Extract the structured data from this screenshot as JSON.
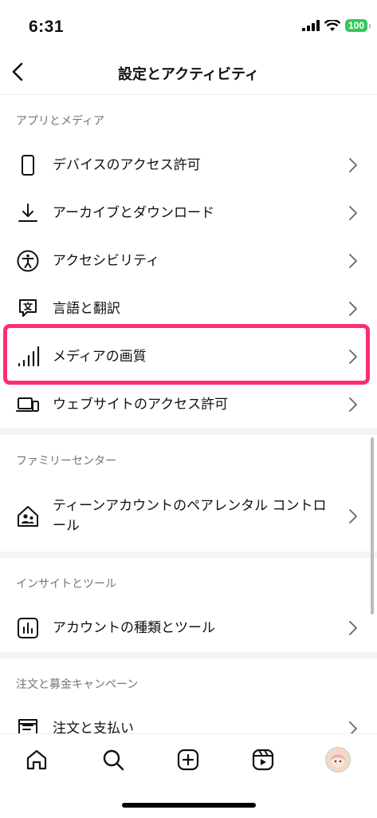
{
  "status": {
    "time": "6:31",
    "battery": "100"
  },
  "header": {
    "title": "設定とアクティビティ"
  },
  "sections": [
    {
      "title": "アプリとメディア",
      "items": [
        {
          "label": "デバイスのアクセス許可",
          "icon": "phone-icon"
        },
        {
          "label": "アーカイブとダウンロード",
          "icon": "download-icon"
        },
        {
          "label": "アクセシビリティ",
          "icon": "accessibility-icon"
        },
        {
          "label": "言語と翻訳",
          "icon": "translate-icon"
        },
        {
          "label": "メディアの画質",
          "icon": "signal-bars-icon",
          "highlighted": true
        },
        {
          "label": "ウェブサイトのアクセス許可",
          "icon": "laptop-phone-icon"
        }
      ]
    },
    {
      "title": "ファミリーセンター",
      "items": [
        {
          "label": "ティーンアカウントのペアレンタル コントロール",
          "icon": "family-home-icon"
        }
      ]
    },
    {
      "title": "インサイトとツール",
      "items": [
        {
          "label": "アカウントの種類とツール",
          "icon": "insights-chart-icon"
        }
      ]
    },
    {
      "title": "注文と募金キャンペーン",
      "items": [
        {
          "label": "注文と支払い",
          "icon": "orders-icon"
        }
      ]
    }
  ],
  "tabbar": [
    "home-icon",
    "search-icon",
    "create-icon",
    "reels-icon",
    "profile-avatar"
  ]
}
